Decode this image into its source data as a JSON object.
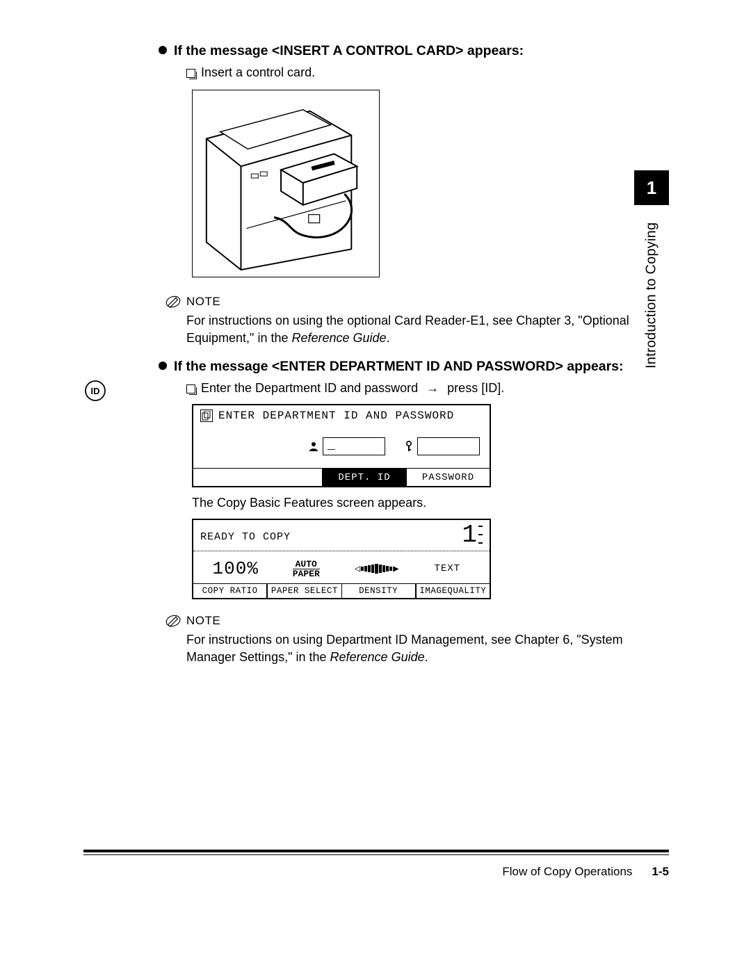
{
  "side": {
    "chapter": "1",
    "label": "Introduction to Copying"
  },
  "section1": {
    "heading": "If the message <INSERT A CONTROL CARD> appears:",
    "action": "Insert a control card."
  },
  "note1": {
    "label": "NOTE",
    "text_a": "For instructions on using the optional Card Reader-E1, see Chapter 3, \"Optional Equipment,\" in the ",
    "text_ital": "Reference Guide",
    "text_b": "."
  },
  "section2": {
    "heading": "If the message <ENTER DEPARTMENT ID AND PASSWORD> appears:",
    "action_a": "Enter the Department ID and password ",
    "action_b": " press [ID]."
  },
  "lcd_login": {
    "title": "ENTER DEPARTMENT ID AND PASSWORD",
    "dept_field": "_",
    "pass_field": "",
    "k1": "DEPT. ID",
    "k2": "PASSWORD"
  },
  "caption": "The Copy Basic Features screen appears.",
  "lcd_copy": {
    "status": "READY TO COPY",
    "count": "1",
    "ratio": "100%",
    "auto_l1": "AUTO",
    "auto_l2": "PAPER",
    "text": "TEXT",
    "k1": "COPY RATIO",
    "k2": "PAPER SELECT",
    "k3": "DENSITY",
    "k4": "IMAGEQUALITY"
  },
  "note2": {
    "label": "NOTE",
    "text_a": "For instructions on using Department ID Management, see Chapter 6, \"System Manager Settings,\" in the ",
    "text_ital": "Reference Guide",
    "text_b": "."
  },
  "footer": {
    "section_title": "Flow of Copy Operations",
    "page": "1-5"
  }
}
